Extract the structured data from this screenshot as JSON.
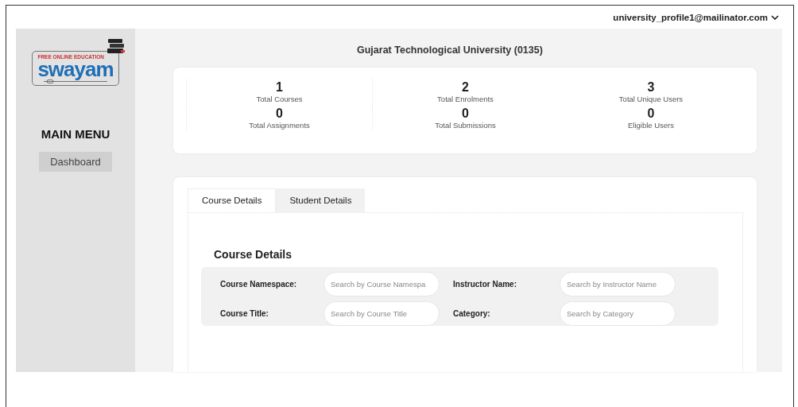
{
  "sidebar": {
    "logo": {
      "tagline": "FREE ONLINE EDUCATION",
      "name": "swayam"
    },
    "menu_title": "MAIN MENU",
    "items": [
      {
        "label": "Dashboard",
        "selected": true
      }
    ]
  },
  "header": {
    "title": "Gujarat Technological University (0135)",
    "user": "university_profile1@mailinator.com"
  },
  "stats": [
    {
      "value": "1",
      "label": "Total Courses"
    },
    {
      "value": "2",
      "label": "Total Enrolments"
    },
    {
      "value": "3",
      "label": "Total Unique Users"
    },
    {
      "value": "0",
      "label": "Total Assignments"
    },
    {
      "value": "0",
      "label": "Total Submissions"
    },
    {
      "value": "0",
      "label": "Eligible Users"
    }
  ],
  "tabs": [
    {
      "label": "Course Details",
      "selected": true
    },
    {
      "label": "Student Details",
      "selected": false
    }
  ],
  "course_details": {
    "heading": "Course Details",
    "filters": [
      {
        "label": "Course Namespace:",
        "placeholder": "Search by Course Namespa"
      },
      {
        "label": "Instructor Name:",
        "placeholder": "Search by Instructor Name"
      },
      {
        "label": "Course Title:",
        "placeholder": "Search by Course Title"
      },
      {
        "label": "Category:",
        "placeholder": "Search by Category"
      }
    ]
  }
}
